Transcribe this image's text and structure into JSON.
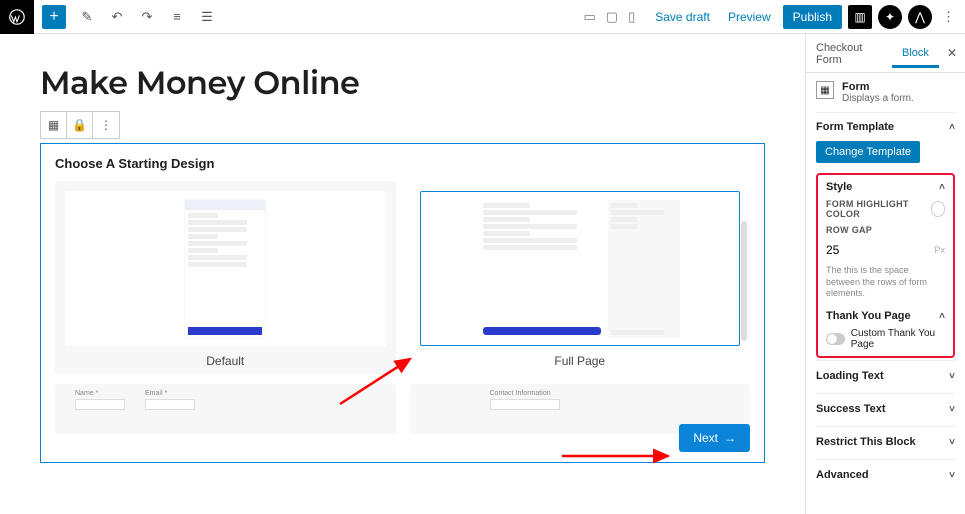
{
  "toolbar": {
    "save_draft": "Save draft",
    "preview": "Preview",
    "publish": "Publish"
  },
  "page": {
    "title": "Make Money Online"
  },
  "formBlock": {
    "heading": "Choose A Starting Design",
    "designs": [
      {
        "label": "Default"
      },
      {
        "label": "Full Page"
      }
    ],
    "next": "Next"
  },
  "sidebar": {
    "tabs": {
      "checkout": "Checkout Form",
      "block": "Block"
    },
    "form": {
      "title": "Form",
      "desc": "Displays a form."
    },
    "panels": {
      "formTemplate": {
        "title": "Form Template",
        "button": "Change Template"
      },
      "style": {
        "title": "Style",
        "highlightLabel": "FORM HIGHLIGHT COLOR",
        "rowGapLabel": "ROW GAP",
        "rowGapValue": "25",
        "rowGapUnit": "Px",
        "helper": "The this is the space between the rows of form elements."
      },
      "thankYou": {
        "title": "Thank You Page",
        "toggleLabel": "Custom Thank You Page"
      },
      "loadingText": "Loading Text",
      "successText": "Success Text",
      "restrict": "Restrict This Block",
      "advanced": "Advanced"
    }
  }
}
